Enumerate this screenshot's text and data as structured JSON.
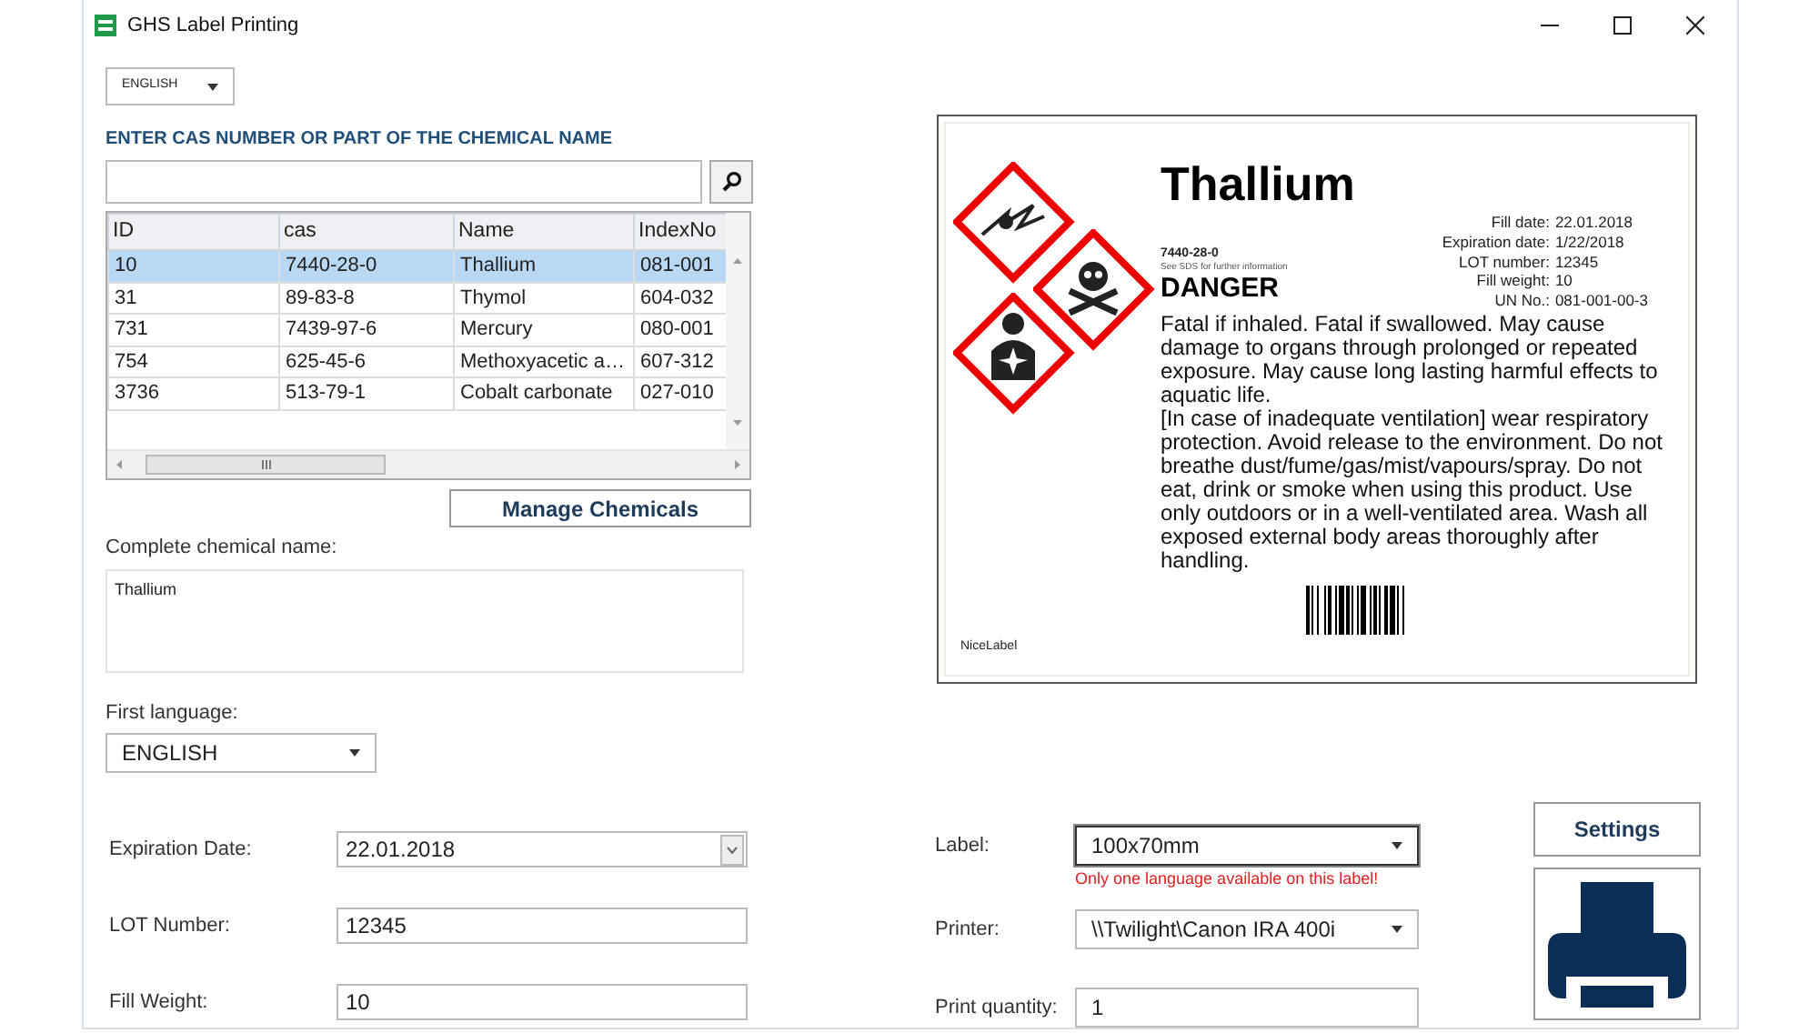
{
  "window": {
    "title": "GHS Label Printing"
  },
  "language_select": {
    "value": "ENGLISH"
  },
  "search": {
    "label": "ENTER CAS NUMBER OR PART OF THE CHEMICAL NAME"
  },
  "table": {
    "columns": [
      "ID",
      "cas",
      "Name",
      "IndexNo"
    ],
    "rows": [
      {
        "cells": [
          "10",
          "7440-28-0",
          "Thallium",
          "081-001"
        ],
        "selected": true
      },
      {
        "cells": [
          "31",
          "89-83-8",
          "Thymol",
          "604-032"
        ],
        "selected": false
      },
      {
        "cells": [
          "731",
          "7439-97-6",
          "Mercury",
          "080-001"
        ],
        "selected": false
      },
      {
        "cells": [
          "754",
          "625-45-6",
          "Methoxyacetic a…",
          "607-312"
        ],
        "selected": false
      },
      {
        "cells": [
          "3736",
          "513-79-1",
          "Cobalt carbonate",
          "027-010"
        ],
        "selected": false
      }
    ]
  },
  "manage_button": "Manage Chemicals",
  "chemical_name": {
    "label": "Complete chemical name:",
    "value": "Thallium"
  },
  "first_language": {
    "label": "First language:",
    "value": "ENGLISH"
  },
  "fields": [
    {
      "label": "Expiration Date:",
      "value": "22.01.2018",
      "kind": "date"
    },
    {
      "label": "LOT Number:",
      "value": "12345",
      "kind": "text"
    },
    {
      "label": "Fill Weight:",
      "value": "10",
      "kind": "text"
    }
  ],
  "print_fields": [
    {
      "label": "Label:",
      "value": "100x70mm",
      "kind": "select",
      "focused": true,
      "warning": "Only one language available on this label!"
    },
    {
      "label": "Printer:",
      "value": "\\\\Twilight\\Canon IRA 400i",
      "kind": "select",
      "focused": false
    },
    {
      "label": "Print quantity:",
      "value": "1",
      "kind": "text",
      "focused": false
    }
  ],
  "settings_button": "Settings",
  "label_preview": {
    "title": "Thallium",
    "cas": "7440-28-0",
    "note": "See SDS for further information",
    "signal_word": "DANGER",
    "details": [
      {
        "label": "Fill date:",
        "value": "22.01.2018"
      },
      {
        "label": "Expiration date:",
        "value": "1/22/2018"
      },
      {
        "label": "LOT number:",
        "value": "12345"
      },
      {
        "label": "Fill weight:",
        "value": "10"
      },
      {
        "label": "UN No.:",
        "value": "081-001-00-3"
      }
    ],
    "statements": [
      "Fatal if inhaled. Fatal if swallowed. May cause damage to organs through prolonged or repeated exposure. May cause long lasting harmful effects to aquatic life.",
      "[In case of inadequate ventilation] wear respiratory protection. Avoid release to the environment. Do not breathe dust/fume/gas/mist/vapours/spray. Do not eat, drink or smoke when using this product. Use only outdoors or in a well-ventilated area. Wash all exposed external body areas thoroughly after handling."
    ],
    "footer": "NiceLabel"
  }
}
